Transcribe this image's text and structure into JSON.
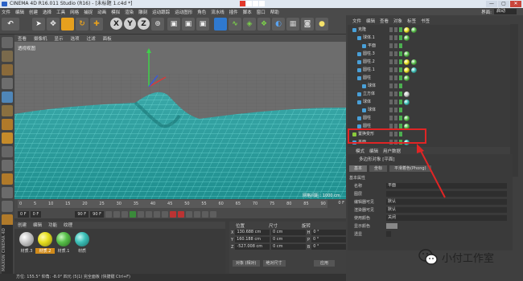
{
  "window": {
    "title": "CINEMA 4D R16.011 Studio (R16) - [未标题 1.c4d *]",
    "controls": [
      "—",
      "▢",
      "✕"
    ]
  },
  "menubar": {
    "items": [
      "文件",
      "编辑",
      "创建",
      "选择",
      "工具",
      "网格",
      "捕捉",
      "动画",
      "模拟",
      "渲染",
      "雕刻",
      "运动跟踪",
      "运动图形",
      "角色",
      "流水线",
      "插件",
      "脚本",
      "窗口",
      "帮助"
    ],
    "layout_label": "界面:",
    "layout_value": "启动"
  },
  "toolbar": {
    "axis_x": "X",
    "axis_y": "Y",
    "axis_z": "Z"
  },
  "viewport": {
    "menu": [
      "查看",
      "摄像机",
      "显示",
      "选项",
      "过滤",
      "面板"
    ],
    "label": "透视视图",
    "grid_info": "网格间距 : 1000 cm"
  },
  "timeline": {
    "ticks": [
      "0",
      "5",
      "10",
      "15",
      "20",
      "25",
      "30",
      "35",
      "40",
      "45",
      "50",
      "55",
      "60",
      "65",
      "70",
      "75",
      "80",
      "85",
      "90"
    ],
    "frame_end": "0 F",
    "current": "0 F",
    "start": "0 F",
    "end": "90 F",
    "max": "90 F"
  },
  "materials": {
    "menu": [
      "创建",
      "编辑",
      "功能",
      "纹理"
    ],
    "items": [
      {
        "label": "材质.3",
        "color": "#c9c9c9"
      },
      {
        "label": "材质.2",
        "color": "#e8e020"
      },
      {
        "label": "材质.1",
        "color": "#58c04a"
      },
      {
        "label": "材质",
        "color": "#3cc0b8"
      }
    ]
  },
  "coordinates": {
    "headers": [
      "位置",
      "尺寸",
      "旋转"
    ],
    "rows": [
      {
        "axis": "X",
        "pos": "130.688 cm",
        "size": "0 cm",
        "rot_label": "H",
        "rot": "0 °"
      },
      {
        "axis": "Y",
        "pos": "160.188 cm",
        "size": "0 cm",
        "rot_label": "P",
        "rot": "0 °"
      },
      {
        "axis": "Z",
        "pos": "-527.008 cm",
        "size": "0 cm",
        "rot_label": "B",
        "rot": "0 °"
      }
    ],
    "mode_object": "对象 (相对)",
    "mode_size": "绝对尺寸",
    "apply": "应用"
  },
  "status_bar": "方位: 155.5°  仰角: -8.0°  四元 (5|1)  完全面板 (快捷键 Ctrl+F)",
  "object_manager": {
    "tabs": [
      "文件",
      "编辑",
      "查看",
      "对象",
      "标签",
      "书签"
    ],
    "objects": [
      {
        "label": "克隆",
        "indent": 0,
        "icon": "#49a0d8",
        "tags": [
          "#e8e020",
          "#58c04a"
        ]
      },
      {
        "label": "球体.1",
        "indent": 1,
        "icon": "#49a0d8",
        "tags": [
          "#58c04a"
        ]
      },
      {
        "label": "平面",
        "indent": 2,
        "icon": "#49a0d8",
        "tags": []
      },
      {
        "label": "圆柱.3",
        "indent": 1,
        "icon": "#49a0d8",
        "tags": [
          "#58c04a"
        ]
      },
      {
        "label": "圆柱.2",
        "indent": 1,
        "icon": "#49a0d8",
        "tags": [
          "#e8e020",
          "#58c04a"
        ]
      },
      {
        "label": "圆柱.1",
        "indent": 1,
        "icon": "#49a0d8",
        "tags": [
          "#e8e020",
          "#3cc0b8"
        ]
      },
      {
        "label": "圆柱",
        "indent": 1,
        "icon": "#49a0d8",
        "tags": [
          "#58c04a"
        ]
      },
      {
        "label": "球体",
        "indent": 2,
        "icon": "#49a0d8",
        "tags": []
      },
      {
        "label": "立方体",
        "indent": 1,
        "icon": "#49a0d8",
        "tags": [
          "#c9c9c9"
        ]
      },
      {
        "label": "球体",
        "indent": 1,
        "icon": "#49a0d8",
        "tags": [
          "#3cc0b8"
        ]
      },
      {
        "label": "球体",
        "indent": 2,
        "icon": "#49a0d8",
        "tags": []
      },
      {
        "label": "圆柱",
        "indent": 1,
        "icon": "#49a0d8",
        "tags": [
          "#58c04a"
        ]
      },
      {
        "label": "圆柱",
        "indent": 1,
        "icon": "#49a0d8",
        "tags": [
          "#58c04a"
        ]
      },
      {
        "label": "置换变形",
        "indent": 0,
        "icon": "#8acb3c",
        "tags": []
      },
      {
        "label": "平面",
        "indent": 0,
        "icon": "#49a0d8",
        "tags": [
          "#3cc0b8"
        ]
      }
    ]
  },
  "attributes": {
    "tabs": [
      "模式",
      "编辑",
      "用户数据"
    ],
    "title": "多边形对象 [平面]",
    "subtabs": [
      "基本",
      "坐标",
      "平滑着色(Phong)"
    ],
    "section": "基本属性",
    "rows": [
      {
        "label": "名称",
        "value": "平面"
      },
      {
        "label": "图层",
        "value": ""
      },
      {
        "label": "编辑器可见",
        "value": "默认"
      },
      {
        "label": "渲染器可见",
        "value": "默认"
      },
      {
        "label": "使用颜色",
        "value": "关闭"
      },
      {
        "label": "显示颜色",
        "value": ""
      },
      {
        "label": "透显",
        "value": ""
      }
    ]
  },
  "watermark": {
    "text": "小付工作室"
  }
}
